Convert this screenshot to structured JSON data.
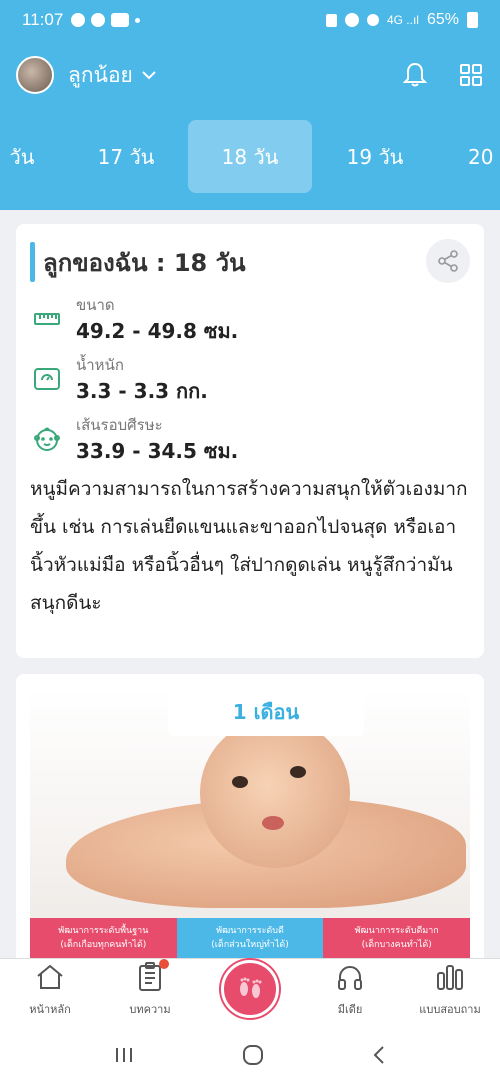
{
  "status_bar": {
    "time": "11:07",
    "battery": "65%"
  },
  "header": {
    "child_name": "ลูกน้อย",
    "days": [
      "วัน",
      "17 วัน",
      "18 วัน",
      "19 วัน",
      "20"
    ],
    "selected_day": "18 วัน"
  },
  "info": {
    "title": "ลูกของฉัน : 18 วัน",
    "stats": [
      {
        "label": "ขนาด",
        "value": "49.2 - 49.8 ซม.",
        "icon": "ruler-icon"
      },
      {
        "label": "น้ำหนัก",
        "value": "3.3 - 3.3 กก.",
        "icon": "scale-icon"
      },
      {
        "label": "เส้นรอบศีรษะ",
        "value": "33.9 - 34.5 ซม.",
        "icon": "baby-face-icon"
      }
    ],
    "description": "หนูมีความสามารถในการสร้างความสนุกให้ตัวเองมากขึ้น เช่น การเล่นยืดแขนและขาออกไปจนสุด หรือเอานิ้วหัวแม่มือ หรือนิ้วอื่นๆ ใส่ปากดูดเล่น หนูรู้สึกว่ามันสนุกดีนะ"
  },
  "article": {
    "month_label": "1 เดือน",
    "dev_levels": [
      {
        "title": "พัฒนาการระดับพื้นฐาน",
        "sub": "(เด็กเกือบทุกคนทำได้)",
        "color": "#e84c6d"
      },
      {
        "title": "พัฒนาการระดับดี",
        "sub": "(เด็กส่วนใหญ่ทำได้)",
        "color": "#4cb8e8"
      },
      {
        "title": "พัฒนาการระดับดีมาก",
        "sub": "(เด็กบางคนทำได้)",
        "color": "#e84c6d"
      }
    ]
  },
  "bottom_nav": [
    {
      "label": "หน้าหลัก",
      "icon": "home-icon"
    },
    {
      "label": "บทความ",
      "icon": "article-icon"
    },
    {
      "label": "",
      "icon": "footprints-icon"
    },
    {
      "label": "มีเดีย",
      "icon": "headphones-icon"
    },
    {
      "label": "แบบสอบถาม",
      "icon": "chart-bars-icon"
    }
  ],
  "colors": {
    "primary": "#4cb8e8",
    "accent": "#e84c6d",
    "stat_icon": "#3aa87a"
  }
}
